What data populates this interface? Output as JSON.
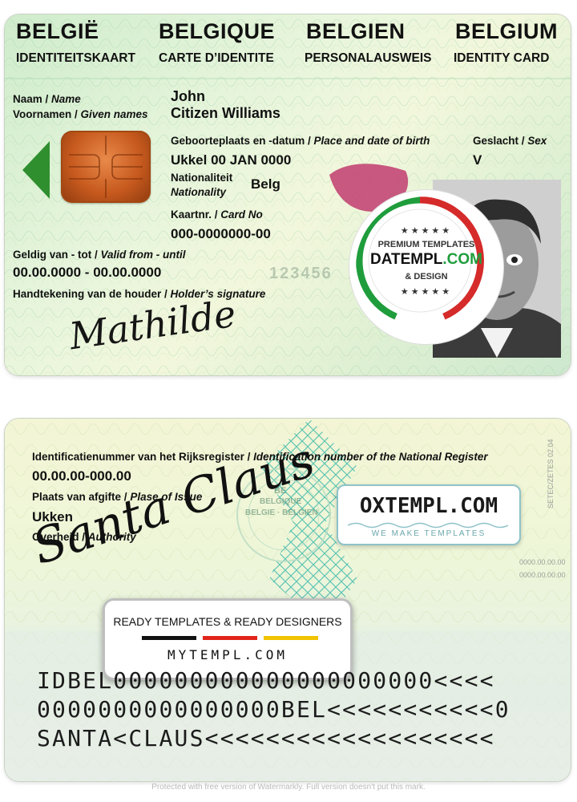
{
  "front": {
    "headers": [
      {
        "title": "BELGIË",
        "subtitle": "IDENTITEITSKAART"
      },
      {
        "title": "BELGIQUE",
        "subtitle": "CARTE D’IDENTITE"
      },
      {
        "title": "BELGIEN",
        "subtitle": "PERSONALAUSWEIS"
      },
      {
        "title": "BELGIUM",
        "subtitle": "IDENTITY CARD"
      }
    ],
    "surname_label_nl": "Naam",
    "surname_label_en": "Name",
    "given_label_nl": "Voornamen",
    "given_label_en": "Given names",
    "surname": "John",
    "given_names": "Citizen Williams",
    "birth_label_nl": "Geboorteplaats en -datum",
    "birth_label_en": "Place and date of birth",
    "birth_value": "Ukkel 00 JAN 0000",
    "sex_label_nl": "Geslacht",
    "sex_label_en": "Sex",
    "sex_value": "V",
    "nationality_label_nl": "Nationaliteit",
    "nationality_label_en": "Nationality",
    "nationality_value": "Belg",
    "card_no_label_nl": "Kaartnr.",
    "card_no_label_en": "Card No",
    "card_no_value": "000-0000000-00",
    "validity_label_nl": "Geldig van - tot",
    "validity_label_en": "Valid from - until",
    "validity_value": "00.00.0000 - 00.00.0000",
    "signature_label_nl": "Handtekening van de houder",
    "signature_label_en": "Holder’s signature",
    "signature": "Mathilde",
    "ghost_number": "123456",
    "badge": {
      "stars": "★★★★★",
      "line1": "PREMIUM TEMPLATES",
      "line2": "DATEMPL",
      "line2_suffix": ".COM",
      "line3": "& DESIGN"
    }
  },
  "back": {
    "nat_reg_label_nl": "Identificatienummer van het Rijksregister",
    "nat_reg_label_en": "Identification number of the National Register",
    "nat_reg_value": "00.00.00-000.00",
    "issue_place_label_nl": "Plaats van afgifte",
    "issue_place_label_en": "Plase of Issue",
    "issue_place_value": "Ukken",
    "authority_label_nl": "Overheid",
    "authority_label_en": "Authority",
    "signature": "Santa Claus",
    "emblem_be": "BE",
    "emblem_line1": "BELGIQUE",
    "emblem_line2": "BELGIE · BELGIEN",
    "side_code1": "SETEC/ZETES 02.04",
    "side_code2": "0000.00.00.00",
    "side_code3": "0000.00.00.00",
    "oxtempl_title": "OXTEMPL.COM",
    "oxtempl_sub": "WE MAKE TEMPLATES",
    "mytempl_title": "READY TEMPLATES & READY DESIGNERS",
    "mytempl_url": "MYTEMPL.COM",
    "mrz": [
      "IDBEL000000000000000000000<<<<",
      "0000000000000000BEL<<<<<<<<<<<0",
      "SANTA<CLAUS<<<<<<<<<<<<<<<<<<<"
    ]
  },
  "watermark": "Protected with free version of Watermarkly. Full version doesn't put this mark.",
  "colors": {
    "chip": "#c75a1e",
    "arrow": "#2f8f2f",
    "flag_green": "#1f9d3c",
    "flag_red": "#d52b2b",
    "oxtempl_border": "#8ec3c7",
    "be_black": "#111111",
    "be_red": "#e1251b",
    "be_yellow": "#f2c300"
  }
}
